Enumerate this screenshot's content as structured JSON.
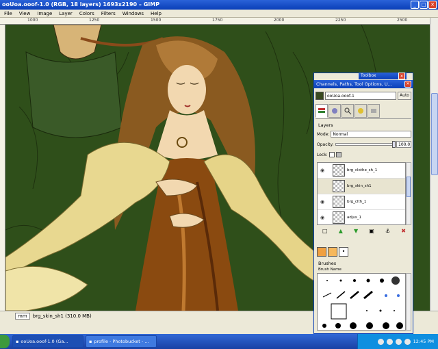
{
  "window": {
    "title": "ooUoa.ooof-1.0 (RGB, 18 layers) 1693x2190 – GIMP",
    "controls": [
      "_",
      "□",
      "✕"
    ]
  },
  "menu": [
    "File",
    "View",
    "Image",
    "Layer",
    "Colors",
    "Filters",
    "Windows",
    "Help"
  ],
  "ruler": {
    "labels": [
      "1000",
      "1250",
      "1500",
      "1750",
      "2000",
      "2250",
      "2500"
    ]
  },
  "status": {
    "unit": "mm",
    "layer_info": "brg_skin_sh1 (310.0 MB)"
  },
  "dock": {
    "tiny_title": "Toolbox",
    "title": "Channels, Paths, Tool Options, U...",
    "image_select": "ooUoa.ooof-1",
    "auto_label": "Auto",
    "layers_heading": "Layers",
    "mode_label": "Mode:",
    "mode_value": "Normal",
    "opacity_label": "Opacity:",
    "opacity_value": "100.0",
    "lock_label": "Lock:",
    "layers": [
      {
        "name": "brg_clothe_sh_1"
      },
      {
        "name": "brg_skin_sh1"
      },
      {
        "name": "brg_clth_1"
      },
      {
        "name": "adjus_1"
      }
    ],
    "brushes_heading": "Brushes",
    "brush_name": "Brush Name"
  },
  "taskbar": {
    "tasks": [
      {
        "label": "ooUoa.ooof-1.0 (Ga..."
      },
      {
        "label": "profile - Photobucket - ..."
      }
    ],
    "clock": "12:45 PM"
  },
  "colors": {
    "accent": "#0a3fb8",
    "canvas_bg": "#2f4f1a",
    "fg_swatch": "#f0a040",
    "bg_swatch": "#f6b85c"
  }
}
